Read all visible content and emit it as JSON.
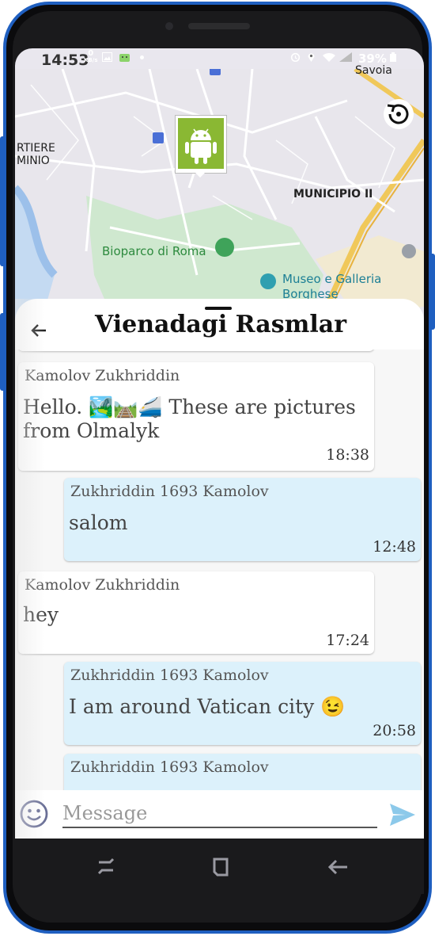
{
  "status_bar": {
    "time": "14:53",
    "kb_value": "0",
    "kb_unit": "KB/s",
    "battery": "39%"
  },
  "map": {
    "labels": {
      "savoia": "Savoia",
      "quartiere": "RTIERE",
      "flaminio": "MINIO",
      "municipio": "MUNICIPIO II",
      "bioparco": "Bioparco di Roma",
      "museo": "Museo e Galleria",
      "borghese": "Borghese"
    }
  },
  "chat": {
    "title": "Vienadagi Rasmlar",
    "messages": [
      {
        "sender": "Kamolov Zukhriddin",
        "text_line1": "Hello. 🏞️🛤️🚄 These are pictures",
        "text_line2": "from Olmalyk",
        "time": "18:38"
      },
      {
        "sender": "Zukhriddin 1693 Kamolov",
        "text": "salom",
        "time": "12:48"
      },
      {
        "sender": "Kamolov  Zukhriddin",
        "text": "hey",
        "time": "17:24"
      },
      {
        "sender": "Zukhriddin 1693 Kamolov",
        "text": "I am around Vatican city 😉",
        "time": "20:58"
      },
      {
        "sender": "Zukhriddin 1693 Kamolov",
        "text": "",
        "time": ""
      }
    ],
    "input_placeholder": "Message"
  },
  "icons": {
    "back": "arrow-left-icon",
    "emoji": "smiley-icon",
    "send": "send-icon",
    "rotate": "rotate-icon",
    "android": "android-icon"
  },
  "colors": {
    "frame": "#1f5fc0",
    "outgoing": "#dcf1fb",
    "send": "#8cc9ea",
    "android_pin": "#8ab833"
  }
}
